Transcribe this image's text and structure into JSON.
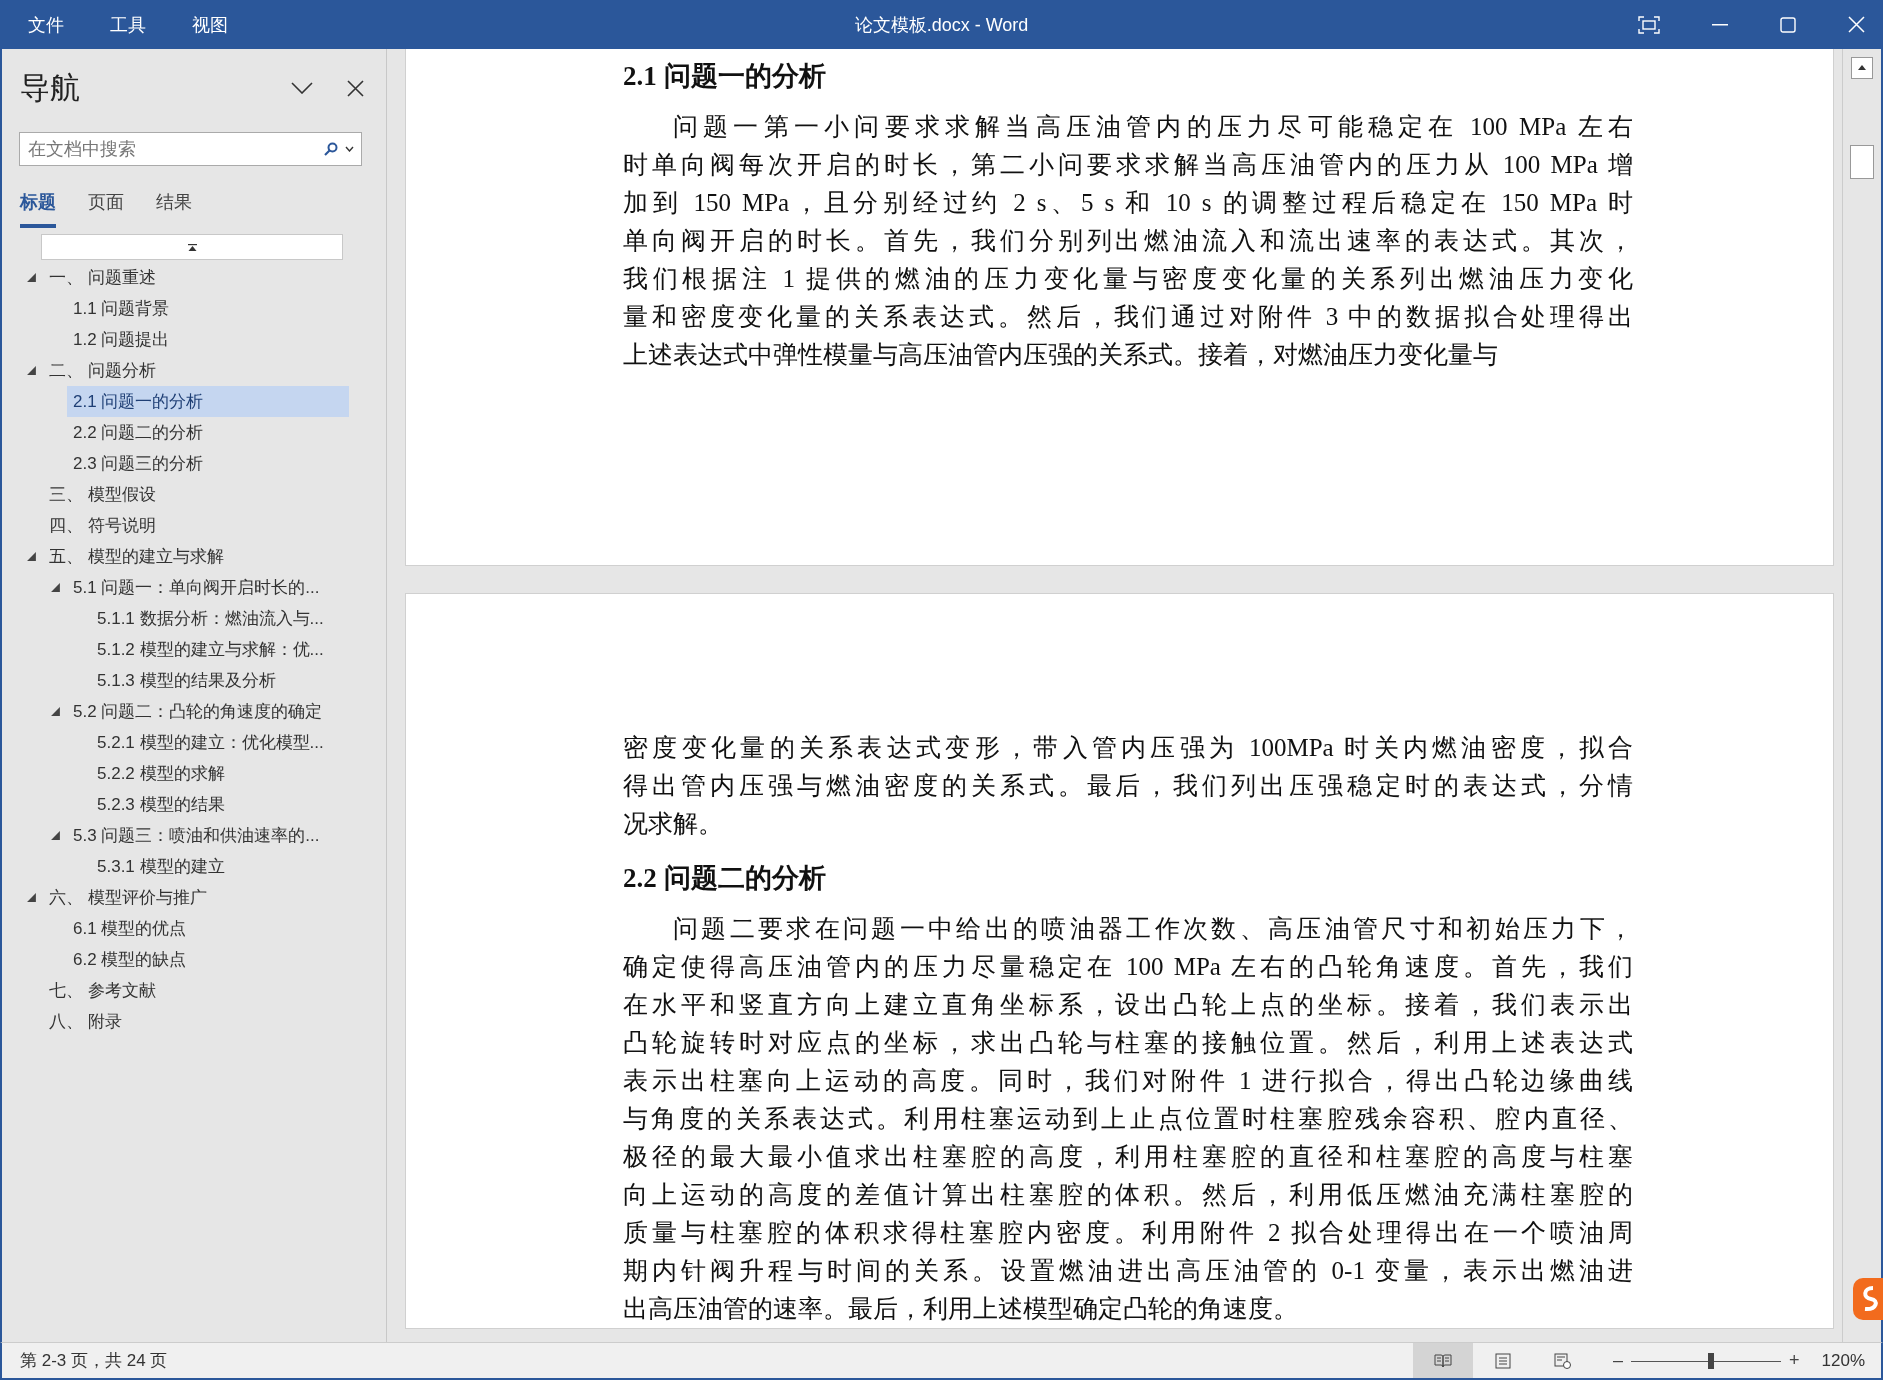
{
  "window": {
    "title": "论文模板.docx - Word",
    "menu": [
      "文件",
      "工具",
      "视图"
    ]
  },
  "navigation": {
    "title": "导航",
    "search": {
      "placeholder": "在文档中搜索"
    },
    "tabs": [
      {
        "label": "标题",
        "selected": true
      },
      {
        "label": "页面",
        "selected": false
      },
      {
        "label": "结果",
        "selected": false
      }
    ],
    "headings": [
      {
        "label": "一、 问题重述",
        "selected": false,
        "expanded": true,
        "children": [
          {
            "label": "1.1 问题背景",
            "selected": false
          },
          {
            "label": "1.2 问题提出",
            "selected": false
          }
        ]
      },
      {
        "label": "二、 问题分析",
        "selected": false,
        "expanded": true,
        "children": [
          {
            "label": "2.1 问题一的分析",
            "selected": true
          },
          {
            "label": "2.2 问题二的分析",
            "selected": false
          },
          {
            "label": "2.3 问题三的分析",
            "selected": false
          }
        ]
      },
      {
        "label": "三、 模型假设",
        "selected": false
      },
      {
        "label": "四、 符号说明",
        "selected": false
      },
      {
        "label": "五、 模型的建立与求解",
        "selected": false,
        "expanded": true,
        "children": [
          {
            "label": "5.1 问题一：单向阀开启时长的...",
            "selected": false,
            "expanded": true,
            "children": [
              {
                "label": "5.1.1 数据分析：燃油流入与...",
                "selected": false
              },
              {
                "label": "5.1.2 模型的建立与求解：优...",
                "selected": false
              },
              {
                "label": "5.1.3 模型的结果及分析",
                "selected": false
              }
            ]
          },
          {
            "label": "5.2 问题二：凸轮的角速度的确定",
            "selected": false,
            "expanded": true,
            "children": [
              {
                "label": "5.2.1 模型的建立：优化模型...",
                "selected": false
              },
              {
                "label": "5.2.2 模型的求解",
                "selected": false
              },
              {
                "label": "5.2.3 模型的结果",
                "selected": false
              }
            ]
          },
          {
            "label": "5.3 问题三：喷油和供油速率的...",
            "selected": false,
            "expanded": true,
            "children": [
              {
                "label": "5.3.1 模型的建立",
                "selected": false
              }
            ]
          }
        ]
      },
      {
        "label": "六、 模型评价与推广",
        "selected": false,
        "expanded": true,
        "children": [
          {
            "label": "6.1 模型的优点",
            "selected": false
          },
          {
            "label": "6.2 模型的缺点",
            "selected": false
          }
        ]
      },
      {
        "label": "七、 参考文献",
        "selected": false
      },
      {
        "label": "八、 附录",
        "selected": false
      }
    ]
  },
  "document": {
    "pages": [
      {
        "blocks": [
          {
            "kind": "heading",
            "text": "2.1 问题一的分析"
          },
          {
            "kind": "paragraph",
            "lines": [
              "问题一第一小问要求求解当高压油管内的压力尽可能稳定在 100 MPa 左右",
              "时单向阀每次开启的时长，第二小问要求求解当高压油管内的压力从 100 MPa 增",
              "加到 150 MPa，且分别经过约 2 s、5 s 和 10 s 的调整过程后稳定在 150 MPa 时",
              "单向阀开启的时长。首先，我们分别列出燃油流入和流出速率的表达式。其次，",
              "我们根据注 1 提供的燃油的压力变化量与密度变化量的关系列出燃油压力变化",
              "量和密度变化量的关系表达式。然后，我们通过对附件 3 中的数据拟合处理得出",
              "上述表达式中弹性模量与高压油管内压强的关系式。接着，对燃油压力变化量与"
            ]
          }
        ]
      },
      {
        "blocks": [
          {
            "kind": "continuation",
            "lines": [
              "密度变化量的关系表达式变形，带入管内压强为 100MPa 时关内燃油密度，拟合",
              "得出管内压强与燃油密度的关系式。最后，我们列出压强稳定时的表达式，分情",
              "况求解。"
            ]
          },
          {
            "kind": "heading",
            "text": "2.2 问题二的分析"
          },
          {
            "kind": "paragraph",
            "lines": [
              "问题二要求在问题一中给出的喷油器工作次数、高压油管尺寸和初始压力下，",
              "确定使得高压油管内的压力尽量稳定在 100 MPa 左右的凸轮角速度。首先，我们",
              "在水平和竖直方向上建立直角坐标系，设出凸轮上点的坐标。接着，我们表示出",
              "凸轮旋转时对应点的坐标，求出凸轮与柱塞的接触位置。然后，利用上述表达式",
              "表示出柱塞向上运动的高度。同时，我们对附件 1 进行拟合，得出凸轮边缘曲线",
              "与角度的关系表达式。利用柱塞运动到上止点位置时柱塞腔残余容积、腔内直径、",
              "极径的最大最小值求出柱塞腔的高度，利用柱塞腔的直径和柱塞腔的高度与柱塞",
              "向上运动的高度的差值计算出柱塞腔的体积。然后，利用低压燃油充满柱塞腔的",
              "质量与柱塞腔的体积求得柱塞腔内密度。利用附件 2 拟合处理得出在一个喷油周",
              "期内针阀升程与时间的关系。设置燃油进出高压油管的 0-1 变量，表示出燃油进",
              "出高压油管的速率。最后，利用上述模型确定凸轮的角速度。"
            ]
          }
        ]
      }
    ]
  },
  "status_bar": {
    "page_info": "第 2-3 页，共 24 页",
    "views": [
      {
        "kind": "read",
        "selected": true
      },
      {
        "kind": "print",
        "selected": false
      },
      {
        "kind": "web",
        "selected": false
      }
    ],
    "zoom": {
      "minus": "–",
      "plus": "+",
      "level": 0.53,
      "reading": "120%"
    }
  }
}
